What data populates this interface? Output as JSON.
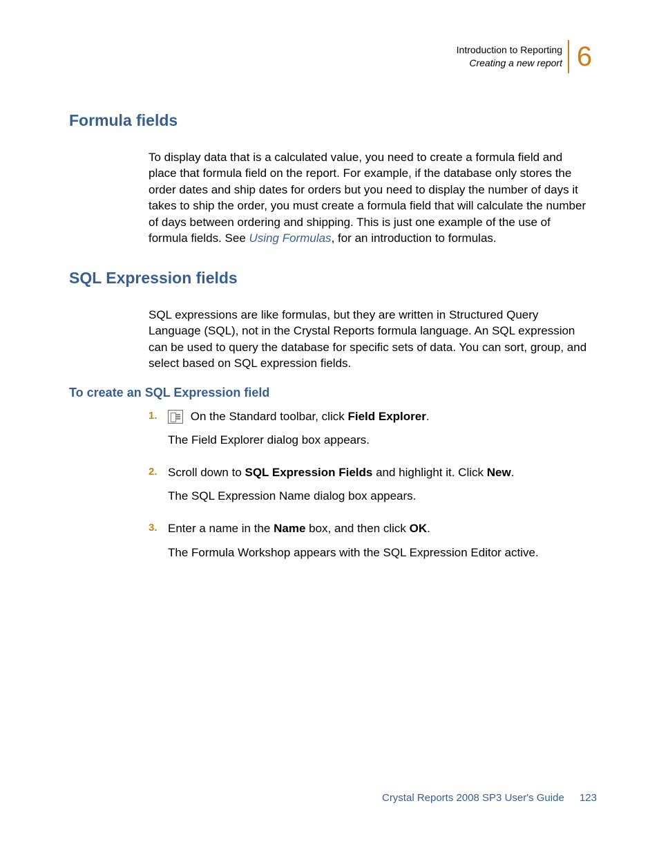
{
  "header": {
    "line1": "Introduction to Reporting",
    "line2": "Creating a new report",
    "chapter": "6"
  },
  "sections": {
    "formula": {
      "title": "Formula fields",
      "para_part1": "To display data that is a calculated value, you need to create a formula field and place that formula field on the report. For example, if the database only stores the order dates and ship dates for orders but you need to display the number of days it takes to ship the order, you must create a formula field that will calculate the number of days between ordering and shipping. This is just one example of the use of formula fields. See ",
      "link": "Using Formulas",
      "para_part2": ", for an introduction to formulas."
    },
    "sql": {
      "title": "SQL Expression fields",
      "para": "SQL expressions are like formulas, but they are written in Structured Query Language (SQL), not in the Crystal Reports formula language. An SQL expression can be used to query the database for specific sets of data. You can sort, group, and select based on SQL expression fields.",
      "subhead": "To create an SQL Expression field",
      "steps": {
        "s1_num": "1.",
        "s1_pre": " On the Standard toolbar, click ",
        "s1_bold": "Field Explorer",
        "s1_post": ".",
        "s1_sub": "The Field Explorer dialog box appears.",
        "s2_num": "2.",
        "s2_pre": "Scroll down to ",
        "s2_bold1": "SQL Expression Fields",
        "s2_mid": " and highlight it. Click ",
        "s2_bold2": "New",
        "s2_post": ".",
        "s2_sub": "The SQL Expression Name dialog box appears.",
        "s3_num": "3.",
        "s3_pre": "Enter a name in the ",
        "s3_bold1": "Name",
        "s3_mid": " box, and then click ",
        "s3_bold2": "OK",
        "s3_post": ".",
        "s3_sub": "The Formula Workshop appears with the SQL Expression Editor active."
      }
    }
  },
  "footer": {
    "text": "Crystal Reports 2008 SP3 User's Guide",
    "page": "123"
  }
}
